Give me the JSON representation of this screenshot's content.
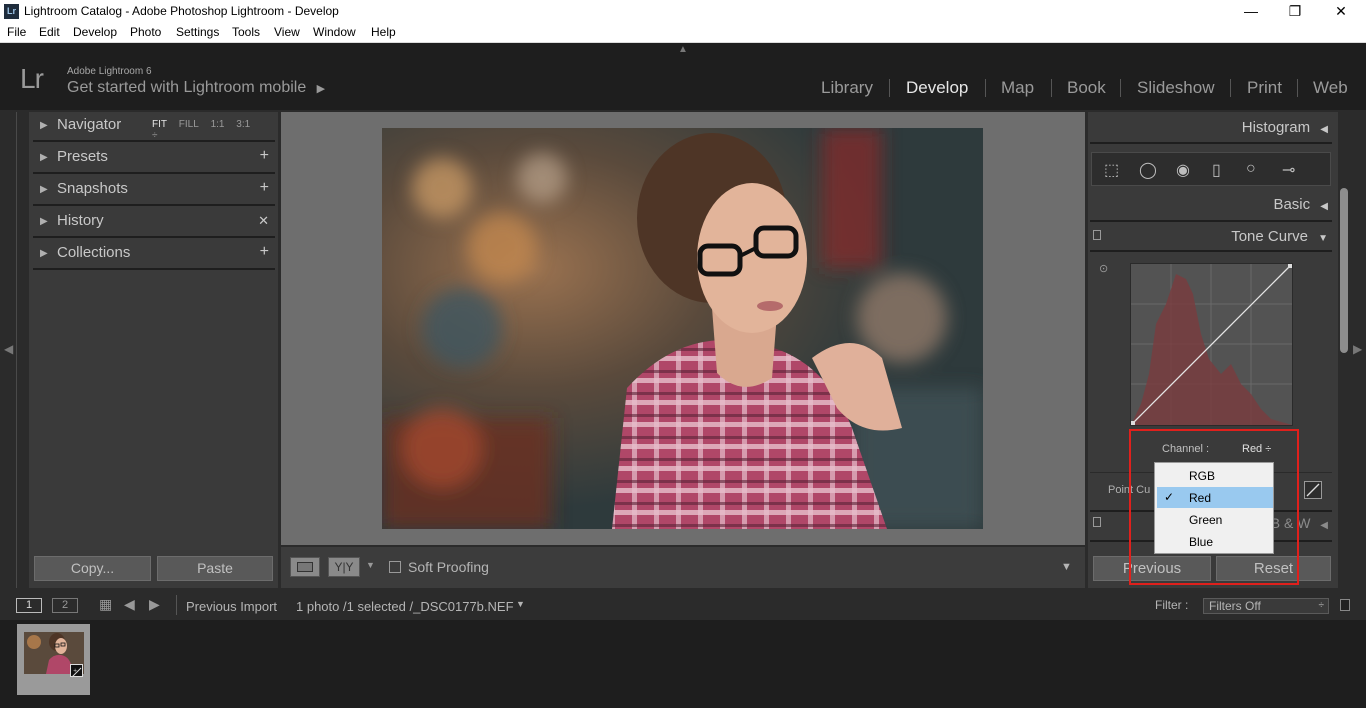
{
  "window": {
    "title": "Lightroom Catalog - Adobe Photoshop Lightroom - Develop",
    "app_icon": "Lr",
    "controls": {
      "minimize": "—",
      "restore": "❐",
      "close": "✕"
    }
  },
  "menu": [
    "File",
    "Edit",
    "Develop",
    "Photo",
    "Settings",
    "Tools",
    "View",
    "Window",
    "Help"
  ],
  "identity": {
    "logo": "Lr",
    "small": "Adobe Lightroom 6",
    "big": "Get started with Lightroom mobile",
    "big_arrow": "▶"
  },
  "modules": [
    "Library",
    "Develop",
    "Map",
    "Book",
    "Slideshow",
    "Print",
    "Web"
  ],
  "active_module": "Develop",
  "left_panel": {
    "navigator": {
      "label": "Navigator",
      "options": [
        "FIT",
        "FILL",
        "1:1",
        "3:1"
      ]
    },
    "presets": "Presets",
    "snapshots": "Snapshots",
    "history": "History",
    "collections": "Collections",
    "copy_button": "Copy...",
    "paste_button": "Paste"
  },
  "toolbar": {
    "soft_proofing": "Soft Proofing",
    "yy": "Y|Y"
  },
  "right_panel": {
    "histogram": "Histogram",
    "basic": "Basic",
    "tone_curve": "Tone Curve",
    "channel_label": "Channel :",
    "channel_value": "Red ÷",
    "point_curve": "Point Cu",
    "bw_partial": "B & W",
    "previous_button": "Previous",
    "reset_button": "Reset"
  },
  "channel_menu": {
    "items": [
      "RGB",
      "Red",
      "Green",
      "Blue"
    ],
    "selected": "Red",
    "check": "✓"
  },
  "filmstrip": {
    "view1": "1",
    "view2": "2",
    "source": "Previous Import",
    "info": "1 photo /1 selected /_DSC0177b.NEF",
    "filter_label": "Filter :",
    "filter_value": "Filters Off"
  },
  "colors": {
    "highlight": "#e0201c",
    "menu_selected": "#99c9ef",
    "panel_bg": "#3a3a3a",
    "background": "#6e6e6e"
  }
}
